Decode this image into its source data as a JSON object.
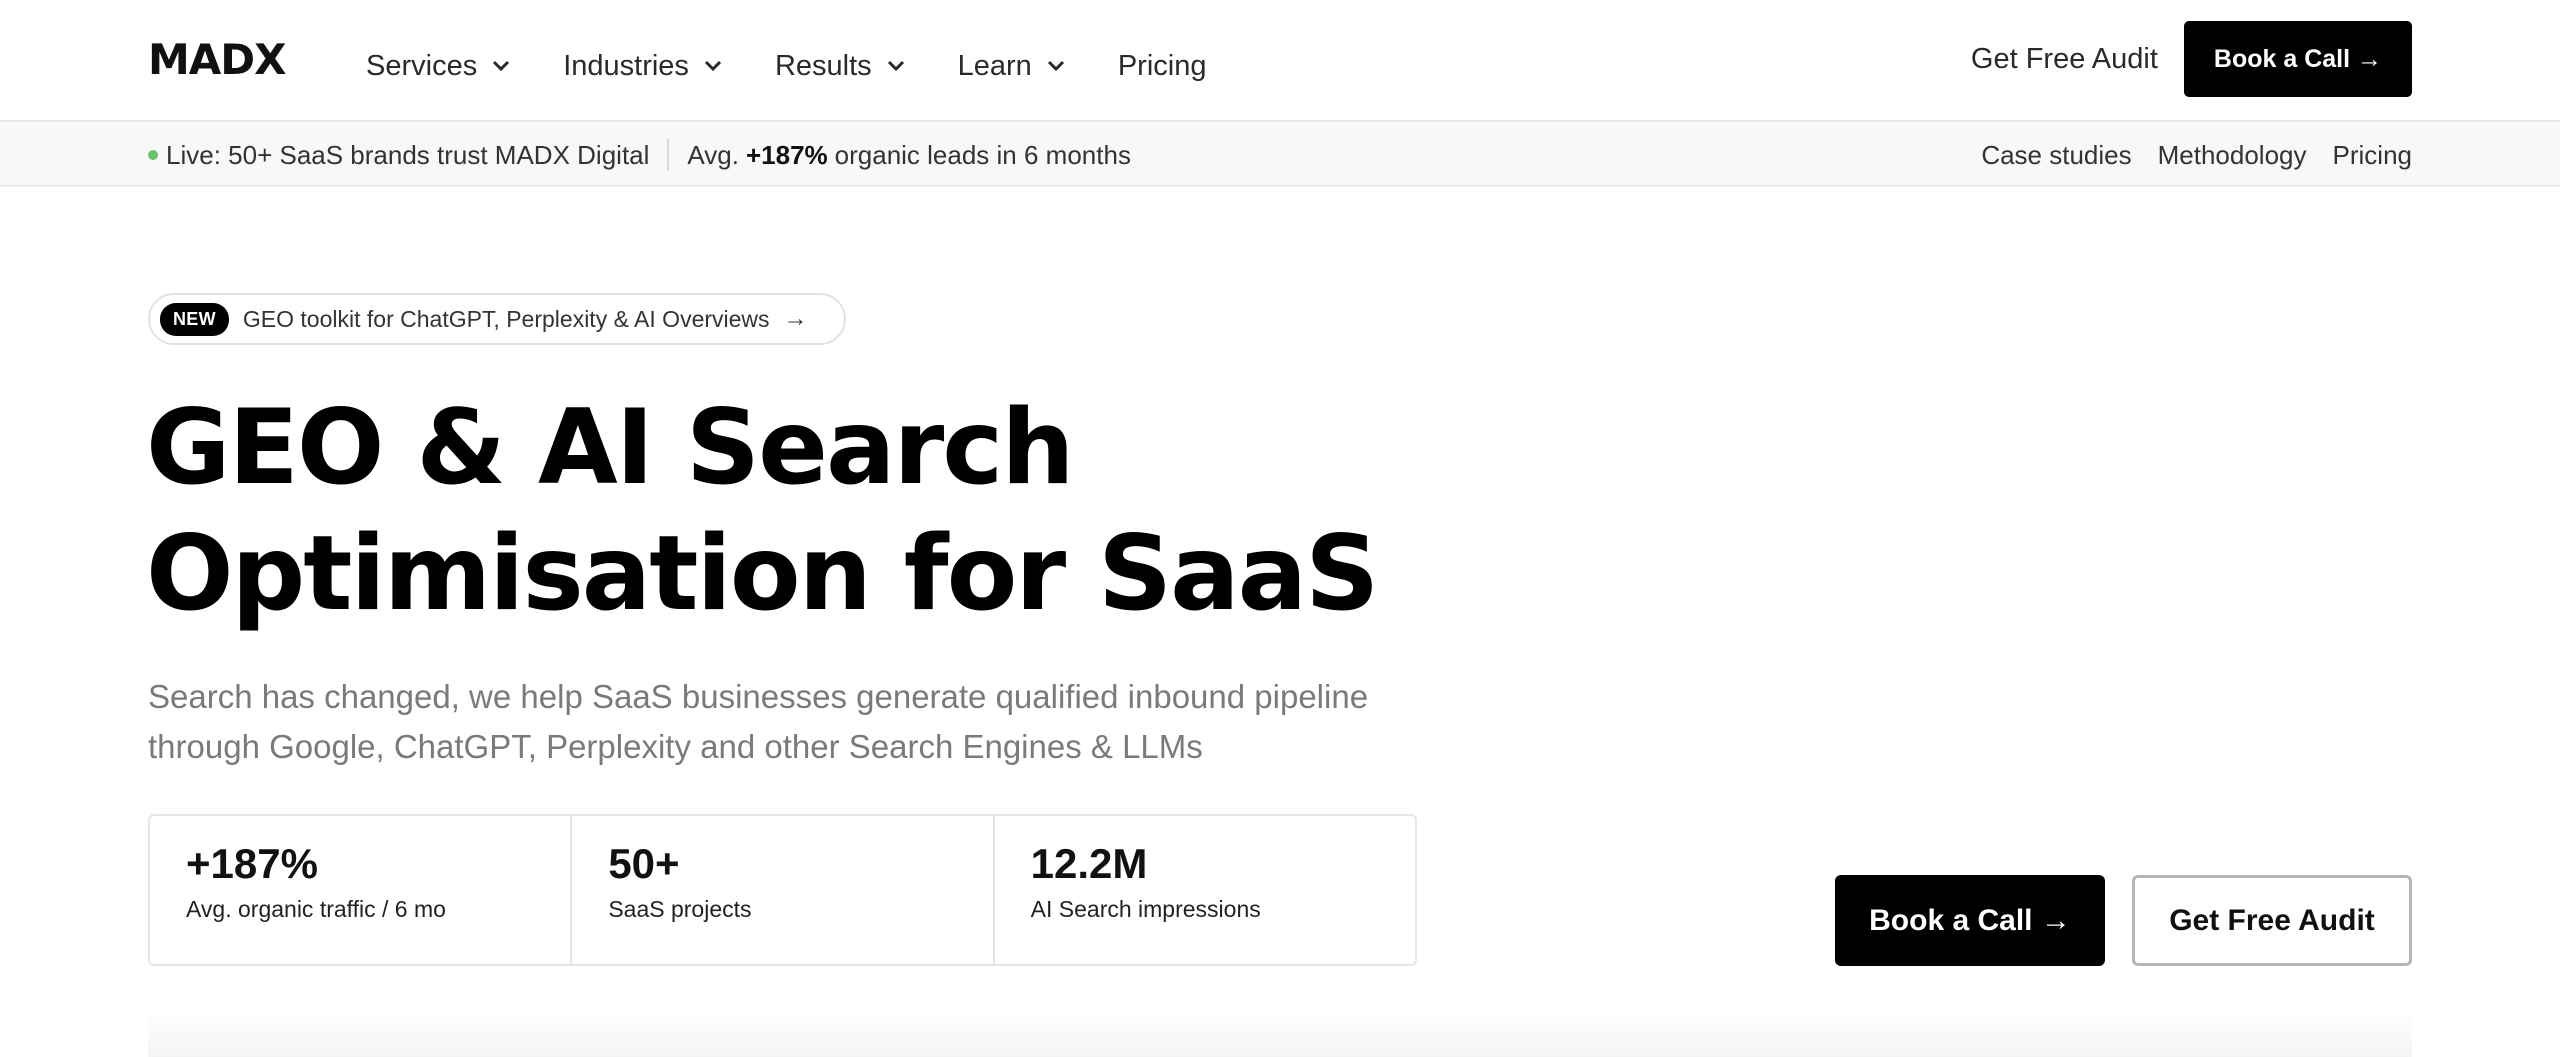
{
  "header": {
    "logo": "MADX",
    "nav": [
      {
        "label": "Services",
        "has_dropdown": true
      },
      {
        "label": "Industries",
        "has_dropdown": true
      },
      {
        "label": "Results",
        "has_dropdown": true
      },
      {
        "label": "Learn",
        "has_dropdown": true
      },
      {
        "label": "Pricing",
        "has_dropdown": false
      }
    ],
    "get_audit_label": "Get Free Audit",
    "book_call_label": "Book a Call →"
  },
  "subbar": {
    "live_text": "Live: 50+ SaaS brands trust MADX Digital",
    "avg_prefix": "Avg.",
    "avg_value": "+187%",
    "avg_suffix": "organic leads in 6 months",
    "links": [
      "Case studies",
      "Methodology",
      "Pricing"
    ]
  },
  "hero": {
    "pill_badge": "NEW",
    "pill_text": "GEO toolkit for ChatGPT, Perplexity & AI Overviews",
    "pill_arrow": "→",
    "title_line1": "GEO & AI Search",
    "title_line2": "Optimisation for SaaS",
    "subtitle_line1": "Search has changed, we help SaaS businesses generate qualified inbound pipeline",
    "subtitle_line2": "through Google, ChatGPT, Perplexity and other Search Engines & LLMs"
  },
  "stats": [
    {
      "value": "+187%",
      "label": "Avg. organic traffic / 6 mo"
    },
    {
      "value": "50+",
      "label": "SaaS projects"
    },
    {
      "value": "12.2M",
      "label": "AI Search impressions"
    }
  ],
  "cta": {
    "primary_label": "Book a Call →",
    "secondary_label": "Get Free Audit"
  },
  "colors": {
    "accent": "#000000",
    "live_dot": "#6cc36c",
    "subtitle_text": "#7a7a7a"
  }
}
